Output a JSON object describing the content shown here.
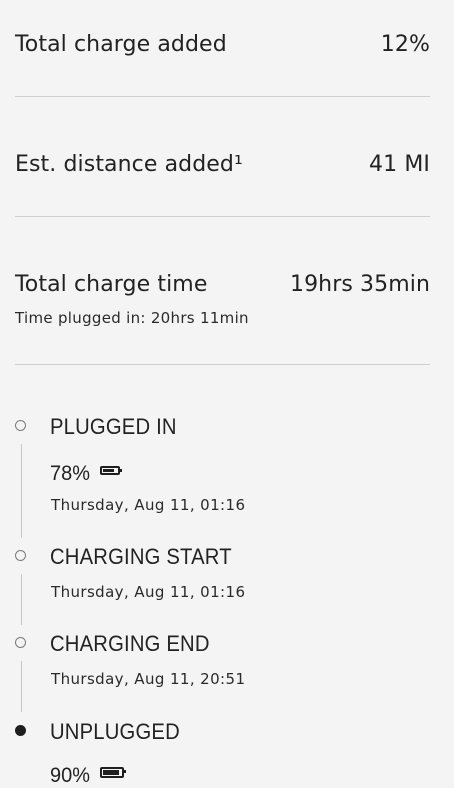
{
  "summary": {
    "total_charge_label": "Total charge added",
    "total_charge_value": "12%",
    "distance_label": "Est. distance added¹",
    "distance_value": "41 MI",
    "charge_time_label": "Total charge time",
    "charge_time_value": "19hrs 35min",
    "plugged_time_text": "Time plugged in: 20hrs 11min"
  },
  "timeline": {
    "plugged_in": {
      "title": "PLUGGED IN",
      "percent": "78%",
      "battery_level": 0.78,
      "date": "Thursday, Aug 11, 01:16"
    },
    "charging_start": {
      "title": "CHARGING START",
      "date": "Thursday, Aug 11, 01:16"
    },
    "charging_end": {
      "title": "CHARGING END",
      "date": "Thursday, Aug 11, 20:51"
    },
    "unplugged": {
      "title": "UNPLUGGED",
      "percent": "90%",
      "battery_level": 0.9
    }
  }
}
